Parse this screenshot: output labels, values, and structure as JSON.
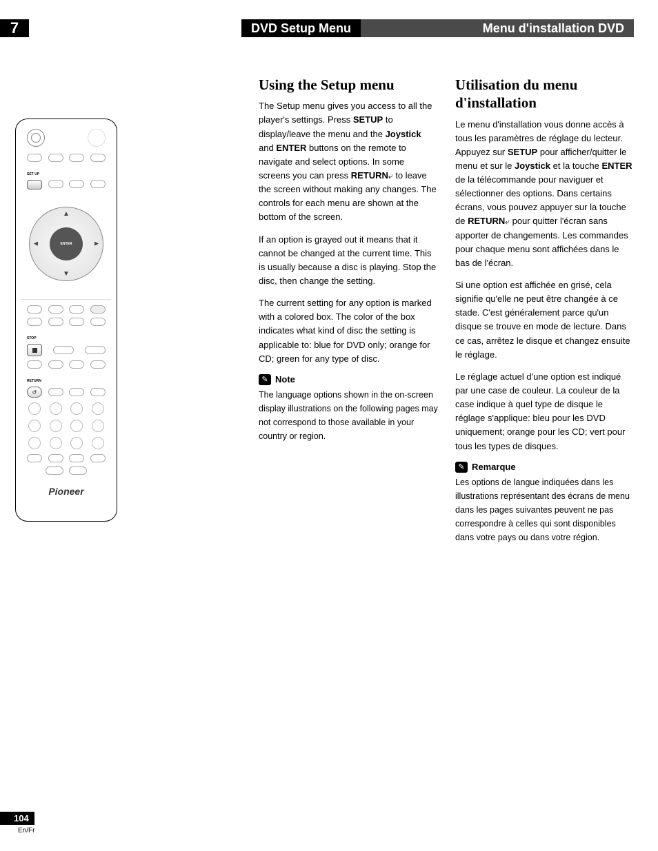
{
  "chapter_number": "7",
  "header_en": "DVD Setup Menu",
  "header_fr": "Menu d'installation DVD",
  "page_number": "104",
  "page_lang": "En/Fr",
  "remote": {
    "setup_label": "SET UP",
    "enter_label": "ENTER",
    "stop_label": "STOP",
    "return_label": "RETURN",
    "brand": "Pioneer"
  },
  "col_en": {
    "title": "Using the Setup menu",
    "p1_a": "The Setup menu gives you access to all the player's settings. Press ",
    "p1_setup": "SETUP",
    "p1_b": " to display/leave the menu and the ",
    "p1_joystick": "Joystick",
    "p1_c": " and ",
    "p1_enter": "ENTER",
    "p1_d": " buttons on the remote to navigate and select options. In some screens you can press ",
    "p1_return": "RETURN",
    "p1_e": " to leave the screen without making any changes. The controls for each menu are shown at the bottom of the screen.",
    "p2": "If an option is grayed out it means that it cannot be changed at the current time. This is usually because a disc is playing. Stop the disc, then change the setting.",
    "p3": "The current setting for any option is marked with a colored box. The color of the box indicates what kind of disc the setting is applicable to: blue for DVD only; orange for CD; green for any type of disc.",
    "note_label": "Note",
    "note_text": "The language options shown in the on-screen display illustrations on the following pages may not correspond to those available in your country or region."
  },
  "col_fr": {
    "title": "Utilisation du menu d'installation",
    "p1_a": "Le menu d'installation vous donne accès à tous les paramètres de réglage du lecteur. Appuyez sur ",
    "p1_setup": "SETUP",
    "p1_b": " pour afficher/quitter le menu et sur le ",
    "p1_joystick": "Joystick",
    "p1_c": " et la touche ",
    "p1_enter": "ENTER",
    "p1_d": " de la télécommande pour naviguer et sélectionner des options. Dans certains écrans, vous pouvez appuyer sur la touche de ",
    "p1_return": "RETURN",
    "p1_e": " pour quitter l'écran sans apporter de changements. Les commandes pour chaque menu sont affichées dans le bas de l'écran.",
    "p2": "Si une option est affichée en grisé, cela signifie qu'elle ne peut être changée à ce stade. C'est généralement parce qu'un disque se trouve en mode de lecture. Dans ce cas, arrêtez le disque et changez ensuite le réglage.",
    "p3": "Le réglage actuel d'une option est indiqué par une case de couleur. La couleur de la case indique à quel type de disque le réglage s'applique: bleu pour les DVD uniquement; orange pour les CD; vert pour tous les types de disques.",
    "note_label": "Remarque",
    "note_text": "Les options de langue indiquées dans les illustrations représentant des écrans de menu dans les pages suivantes peuvent ne pas correspondre à celles qui sont disponibles dans votre pays ou dans votre région."
  }
}
